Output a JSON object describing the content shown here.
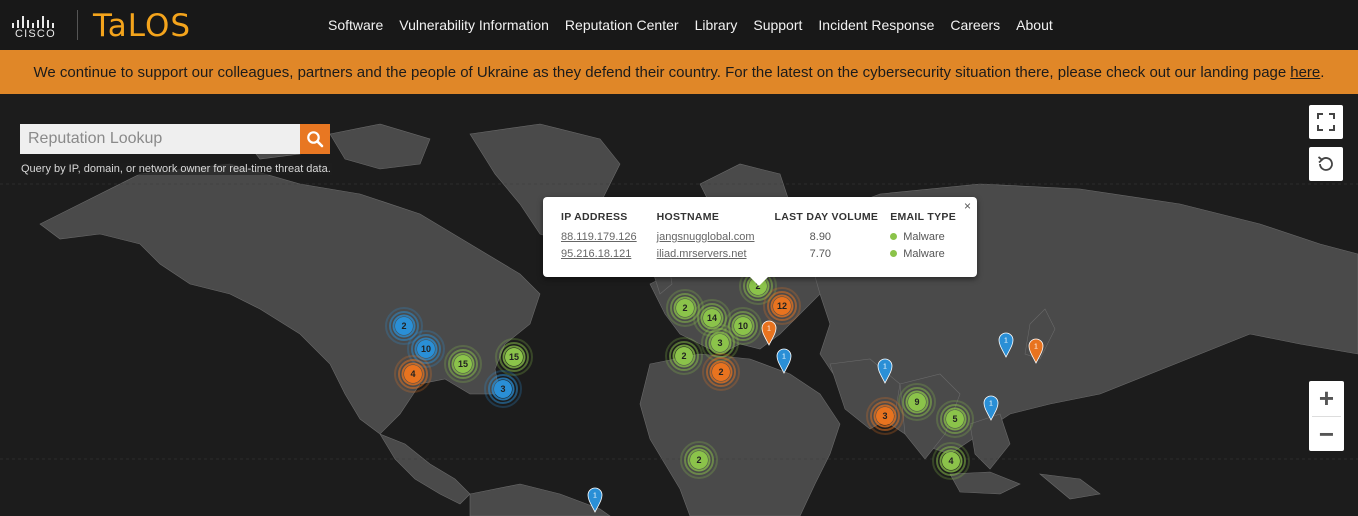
{
  "brand": {
    "cisco": "CISCO",
    "talos": "TaLOS"
  },
  "nav": [
    "Software",
    "Vulnerability Information",
    "Reputation Center",
    "Library",
    "Support",
    "Incident Response",
    "Careers",
    "About"
  ],
  "banner": {
    "text": "We continue to support our colleagues, partners and the people of Ukraine as they defend their country. For the latest on the cybersecurity situation there, please check out our landing page",
    "link": "here",
    "tail": "."
  },
  "search": {
    "placeholder": "Reputation Lookup",
    "hint": "Query by IP, domain, or network owner for real-time threat data."
  },
  "popup": {
    "headers": [
      "IP ADDRESS",
      "HOSTNAME",
      "LAST DAY VOLUME",
      "EMAIL TYPE"
    ],
    "rows": [
      {
        "ip": "88.119.179.126",
        "host": "jangsnugglobal.com",
        "volume": "8.90",
        "type": "Malware"
      },
      {
        "ip": "95.216.18.121",
        "host": "iliad.mrservers.net",
        "volume": "7.70",
        "type": "Malware"
      }
    ],
    "close": "×"
  },
  "zoom": {
    "in": "+",
    "out": "−"
  },
  "colors": {
    "green": "#8bc34a",
    "orange": "#e8731f",
    "blue": "#2a8fd6",
    "banner": "#e08728",
    "accent": "#f4a41c"
  },
  "clusters": [
    {
      "label": "2",
      "color": "blue"
    },
    {
      "label": "10",
      "color": "blue"
    },
    {
      "label": "4",
      "color": "orange"
    },
    {
      "label": "15",
      "color": "green"
    },
    {
      "label": "15",
      "color": "green"
    },
    {
      "label": "3",
      "color": "blue"
    },
    {
      "label": "2",
      "color": "green"
    },
    {
      "label": "14",
      "color": "green"
    },
    {
      "label": "10",
      "color": "green"
    },
    {
      "label": "3",
      "color": "green"
    },
    {
      "label": "2",
      "color": "green"
    },
    {
      "label": "2",
      "color": "orange"
    },
    {
      "label": "2",
      "color": "green"
    },
    {
      "label": "12",
      "color": "orange"
    },
    {
      "label": "9",
      "color": "green"
    },
    {
      "label": "3",
      "color": "orange"
    },
    {
      "label": "5",
      "color": "green"
    },
    {
      "label": "4",
      "color": "green"
    },
    {
      "label": "2",
      "color": "green"
    }
  ],
  "pins": [
    {
      "label": "1",
      "color": "orange"
    },
    {
      "label": "1",
      "color": "blue"
    },
    {
      "label": "1",
      "color": "blue"
    },
    {
      "label": "1",
      "color": "blue"
    },
    {
      "label": "1",
      "color": "orange"
    },
    {
      "label": "1",
      "color": "blue"
    },
    {
      "label": "1",
      "color": "blue"
    }
  ]
}
